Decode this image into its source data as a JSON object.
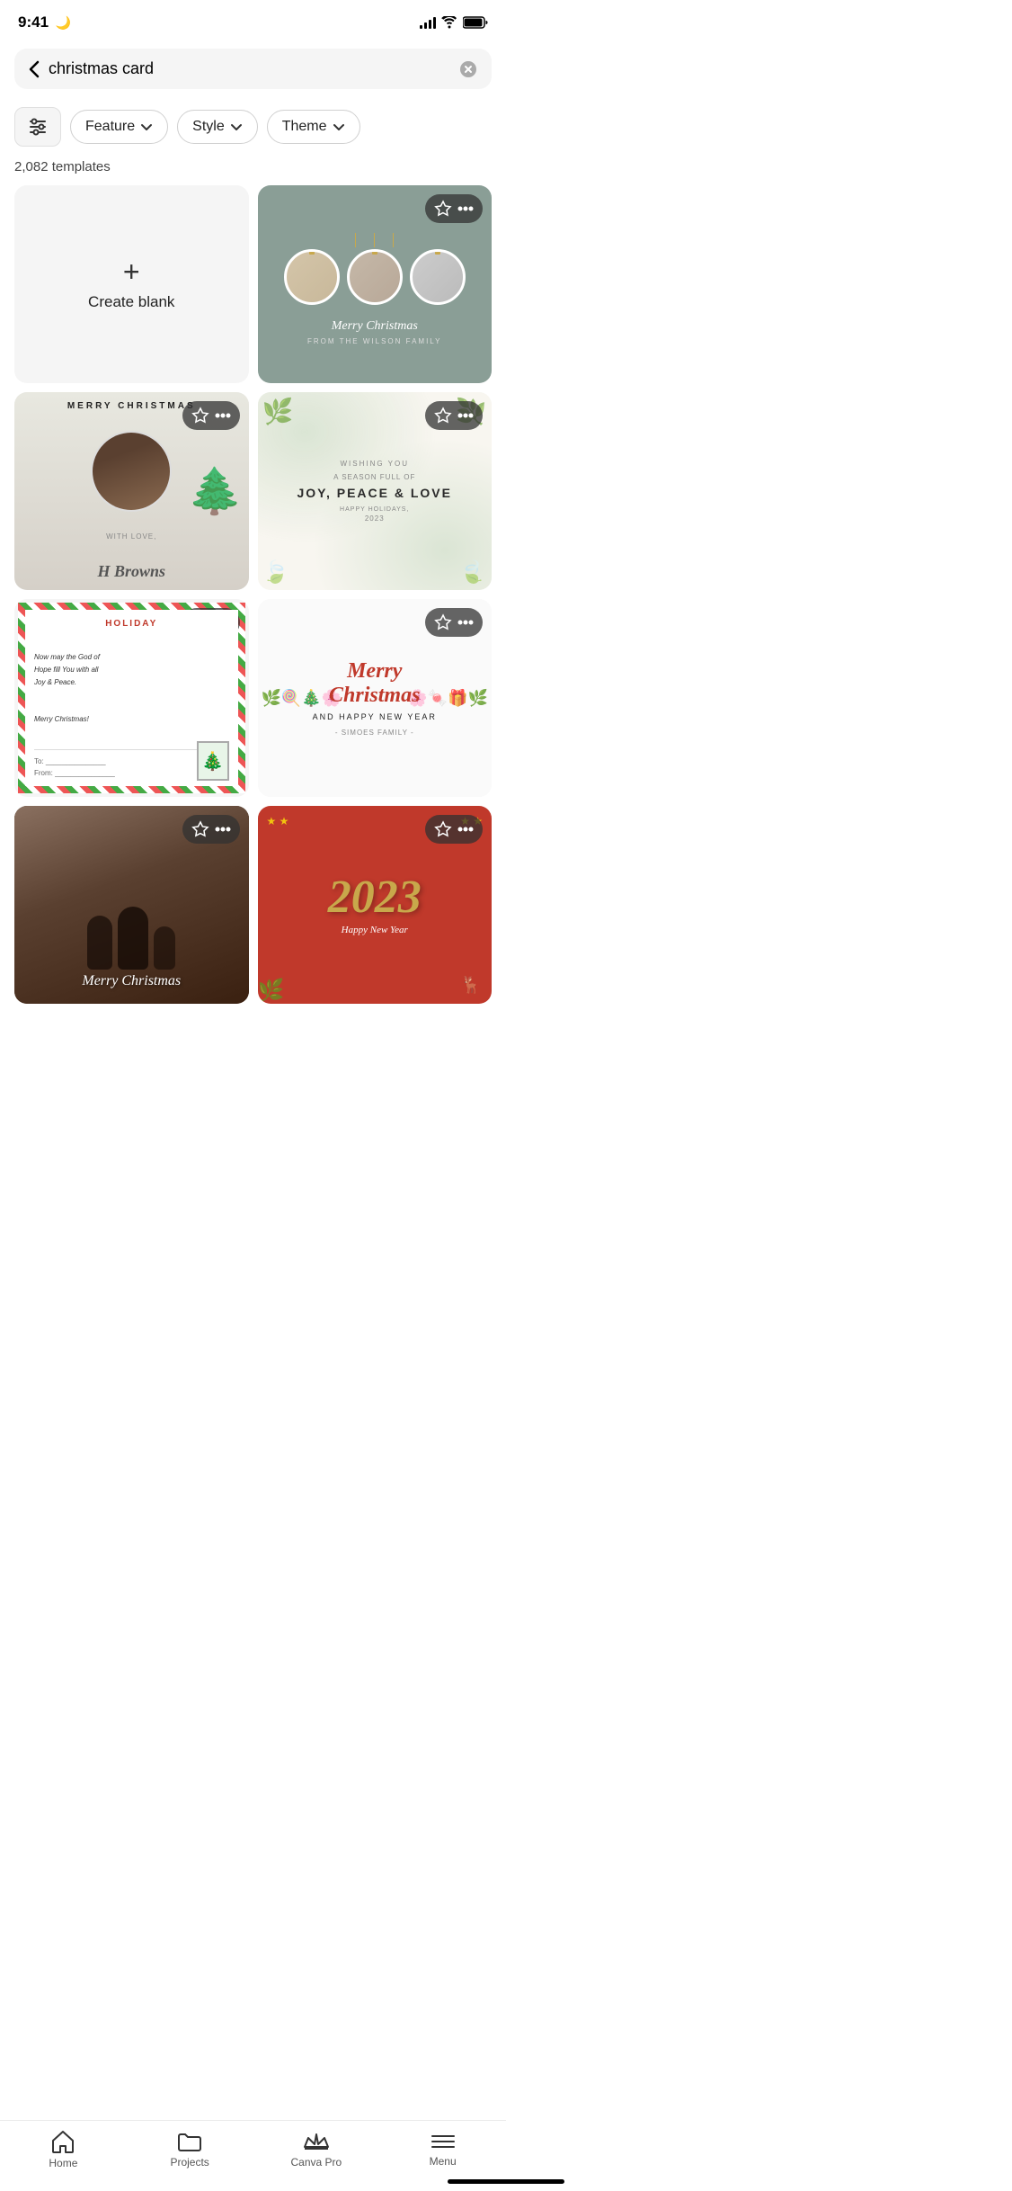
{
  "statusBar": {
    "time": "9:41",
    "moonIcon": "🌙"
  },
  "search": {
    "query": "christmas card",
    "backLabel": "back",
    "clearLabel": "clear"
  },
  "filters": {
    "filterIconLabel": "filters",
    "pills": [
      {
        "id": "feature",
        "label": "Feature",
        "hasChevron": true
      },
      {
        "id": "style",
        "label": "Style",
        "hasChevron": true
      },
      {
        "id": "theme",
        "label": "Theme",
        "hasChevron": true
      }
    ]
  },
  "templateCount": "2,082 templates",
  "createBlank": {
    "plusIcon": "+",
    "label": "Create blank"
  },
  "templates": [
    {
      "id": "ornaments",
      "description": "Gray ornaments Merry Christmas from The Wilson Family"
    },
    {
      "id": "merry-couple",
      "description": "Merry Christmas couple with tree"
    },
    {
      "id": "botanical",
      "description": "Joy Peace and Love botanical floral"
    },
    {
      "id": "holiday-letter",
      "description": "Holiday letter green red stripes"
    },
    {
      "id": "merry-colorful",
      "description": "Merry Christmas colorful decorations Simoes Family"
    },
    {
      "id": "photo-couple",
      "description": "Merry Christmas outdoor couple photo"
    },
    {
      "id": "2023-red",
      "description": "2023 Happy New Year red background"
    }
  ],
  "bottomNav": {
    "items": [
      {
        "id": "home",
        "label": "Home",
        "icon": "home"
      },
      {
        "id": "projects",
        "label": "Projects",
        "icon": "folder"
      },
      {
        "id": "canvapro",
        "label": "Canva Pro",
        "icon": "crown"
      },
      {
        "id": "menu",
        "label": "Menu",
        "icon": "menu"
      }
    ]
  }
}
